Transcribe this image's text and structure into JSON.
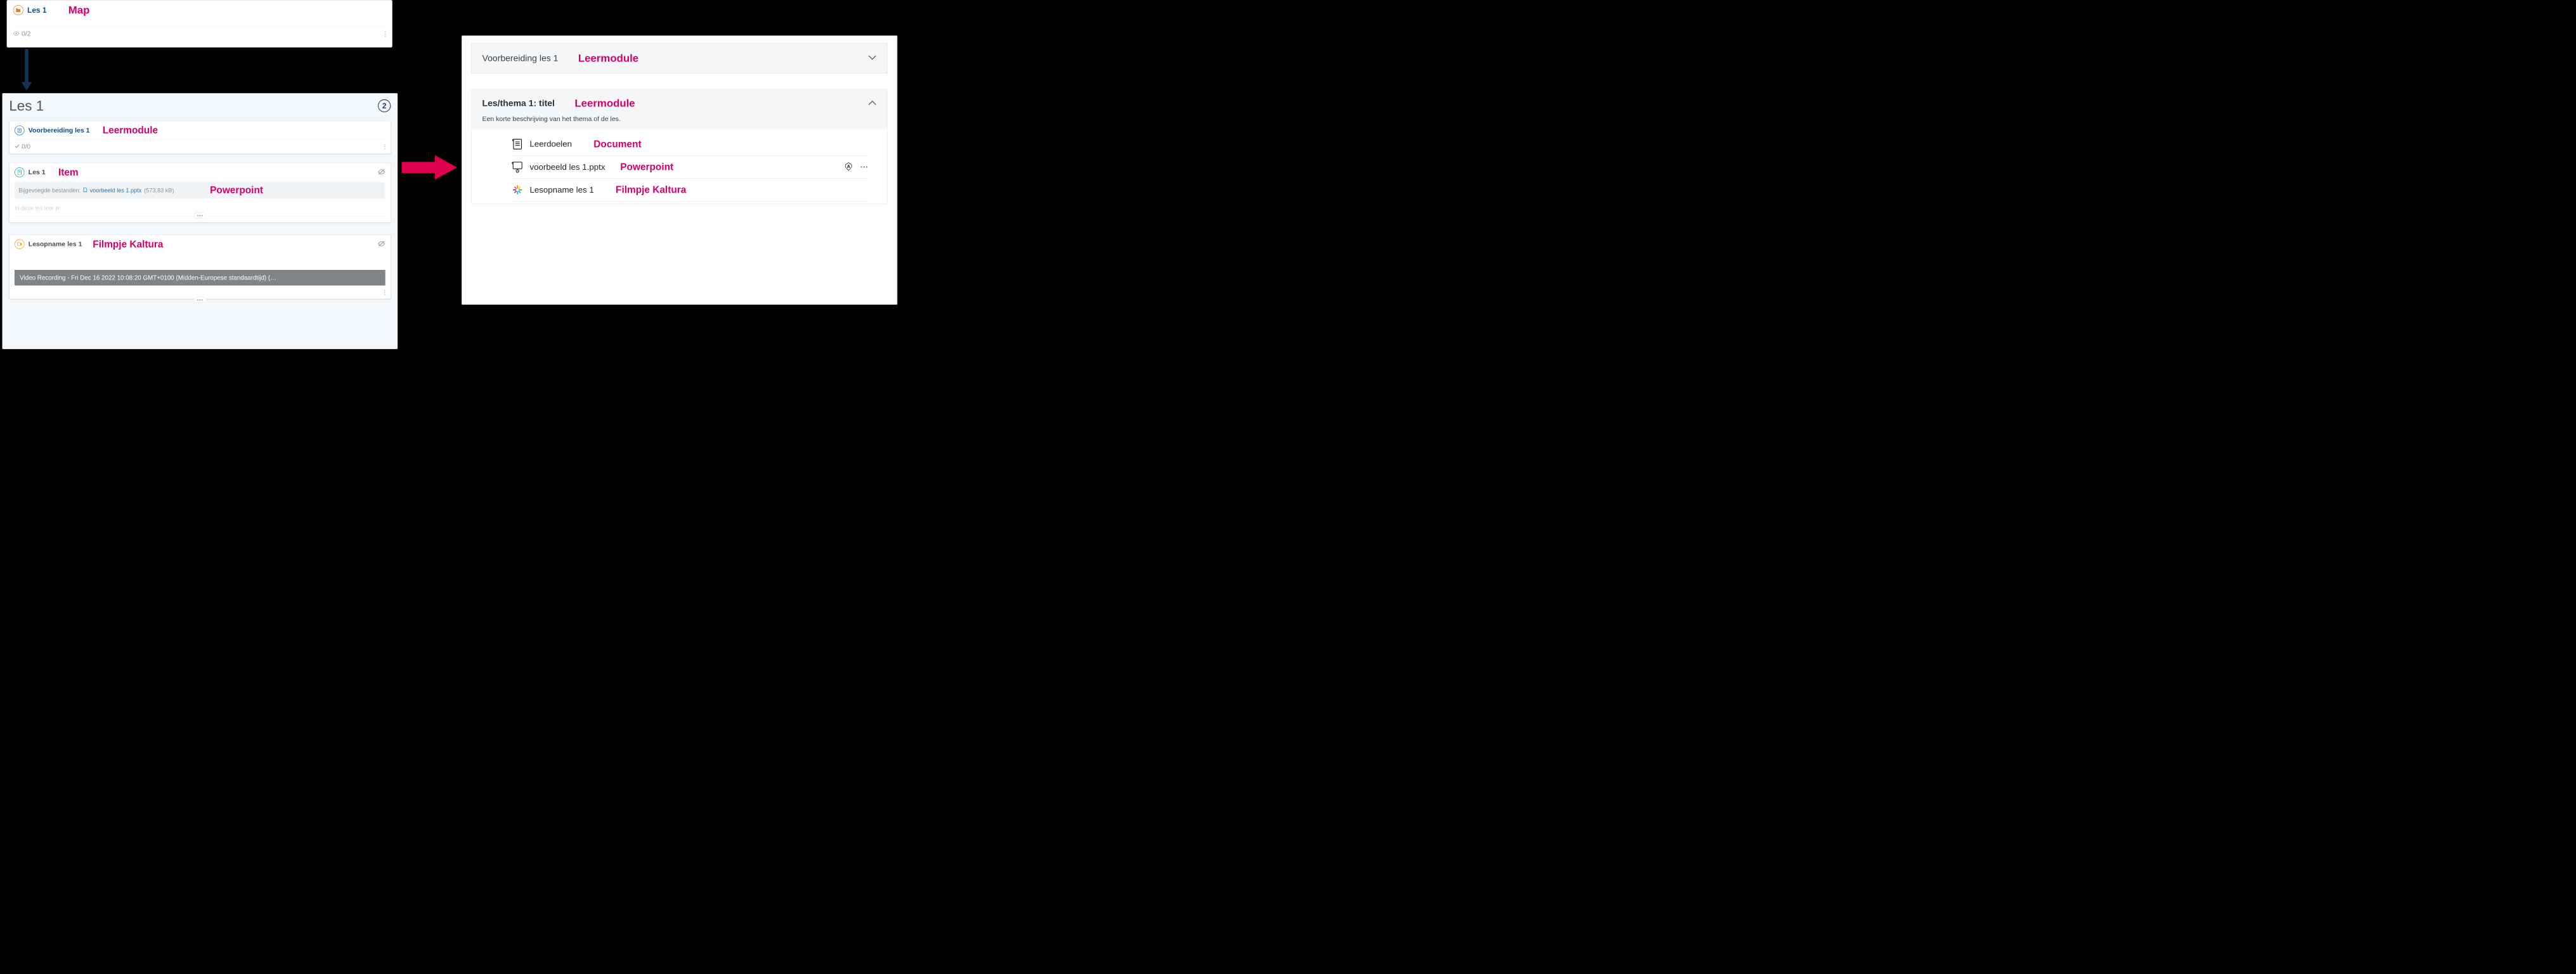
{
  "colors": {
    "accent": "#d5006d",
    "navy": "#13335a",
    "linkBlue": "#0a4a8a",
    "teal": "#00a3a1",
    "gray": "#8a9199"
  },
  "annotations": {
    "map": "Map",
    "leermodule": "Leermodule",
    "item": "Item",
    "powerpoint": "Powerpoint",
    "filmpje": "Filmpje Kaltura",
    "document": "Document"
  },
  "original": {
    "folder": {
      "title": "Les 1",
      "views": "0/2"
    },
    "page": {
      "title": "Les 1",
      "count": "2"
    },
    "voorbereiding": {
      "title": "Voorbereiding les 1",
      "progress": "0/0"
    },
    "item": {
      "title": "Les 1",
      "attach_label": "Bijgevoegde bestanden:",
      "attach_file": "voorbeeld les 1.pptx",
      "attach_size": "(573,83 kB)",
      "faint": "In deze les leer je:"
    },
    "lesopname": {
      "title": "Lesopname les 1",
      "video_caption": "Video Recording - Fri Dec 16 2022 10:08:20 GMT+0100 (Midden-Europese standaardtijd) (…"
    }
  },
  "ultra": {
    "collapsed": {
      "title": "Voorbereiding les 1"
    },
    "expanded": {
      "title": "Les/thema 1: titel",
      "desc": "Een korte beschrijving van het thema of de les.",
      "items": {
        "leerdoelen": "Leerdoelen",
        "pptx": "voorbeeld les 1.pptx",
        "lesopname": "Lesopname les 1"
      }
    }
  }
}
